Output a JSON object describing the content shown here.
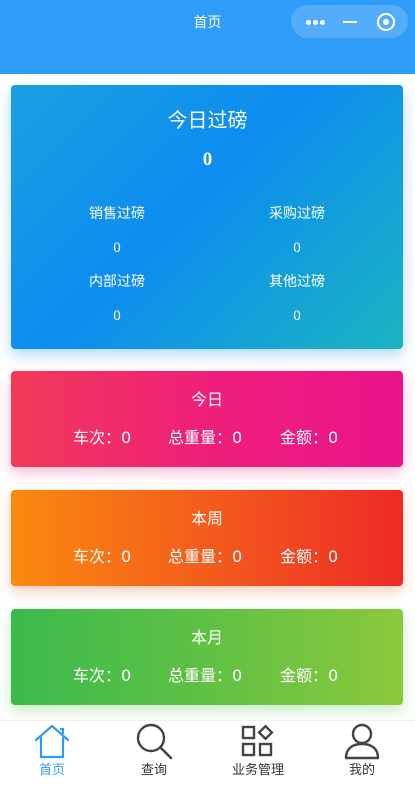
{
  "header": {
    "title": "首页"
  },
  "summary": {
    "title": "今日过磅",
    "total": "0",
    "stats": [
      {
        "label": "销售过磅",
        "value": "0"
      },
      {
        "label": "采购过磅",
        "value": "0"
      },
      {
        "label": "内部过磅",
        "value": "0"
      },
      {
        "label": "其他过磅",
        "value": "0"
      }
    ]
  },
  "periods": [
    {
      "title": "今日",
      "trips": "车次：0",
      "weight": "总重量：0",
      "amount": "金额：0"
    },
    {
      "title": "本周",
      "trips": "车次：0",
      "weight": "总重量：0",
      "amount": "金额：0"
    },
    {
      "title": "本月",
      "trips": "车次：0",
      "weight": "总重量：0",
      "amount": "金额：0"
    }
  ],
  "tabbar": {
    "items": [
      {
        "label": "首页",
        "icon": "home-icon",
        "active": true
      },
      {
        "label": "查询",
        "icon": "search-icon",
        "active": false
      },
      {
        "label": "业务管理",
        "icon": "grid-icon",
        "active": false
      },
      {
        "label": "我的",
        "icon": "user-icon",
        "active": false
      }
    ]
  },
  "colors": {
    "header": "#2f9cf9",
    "tab_active": "#2f9cf9",
    "tab_inactive": "#333333"
  }
}
